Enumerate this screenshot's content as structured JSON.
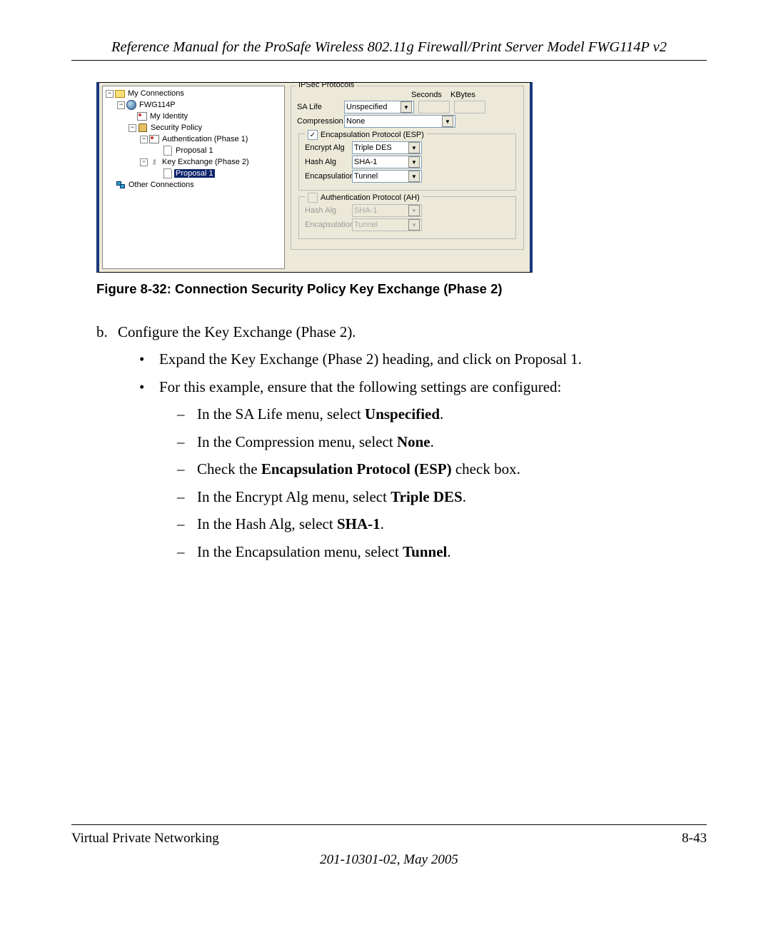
{
  "header": {
    "title": "Reference Manual for the ProSafe Wireless 802.11g  Firewall/Print Server Model FWG114P v2"
  },
  "screenshot": {
    "tree": {
      "my_connections": "My Connections",
      "fwg114p": "FWG114P",
      "my_identity": "My Identity",
      "security_policy": "Security Policy",
      "auth_phase1": "Authentication (Phase 1)",
      "proposal1_a": "Proposal 1",
      "key_exchange": "Key Exchange (Phase 2)",
      "proposal1_b": "Proposal 1",
      "other_connections": "Other Connections",
      "minus": "−",
      "open": "⊟"
    },
    "ipsec": {
      "group": "IPSec Protocols",
      "seconds": "Seconds",
      "kbytes": "KBytes",
      "sa_life": "SA Life",
      "sa_life_val": "Unspecified",
      "compression": "Compression",
      "compression_val": "None",
      "esp_check": "✓",
      "esp_label": "Encapsulation Protocol (ESP)",
      "encrypt_alg": "Encrypt Alg",
      "encrypt_alg_val": "Triple DES",
      "hash_alg": "Hash Alg",
      "hash_alg_val": "SHA-1",
      "encapsulation": "Encapsulation",
      "encapsulation_val": "Tunnel",
      "ah_label": "Authentication Protocol (AH)",
      "ah_hash_alg": "Hash Alg",
      "ah_hash_alg_val": "SHA-1",
      "ah_encap": "Encapsulation",
      "ah_encap_val": "Tunnel",
      "dd": "▼"
    }
  },
  "figure": {
    "caption": "Figure 8-32:  Connection Security Policy Key Exchange (Phase 2)"
  },
  "body": {
    "b_marker": "b.",
    "b_text": "Configure the Key Exchange (Phase 2).",
    "bullet": "•",
    "dash": "–",
    "b1": "Expand the Key Exchange (Phase 2) heading, and click on Proposal 1.",
    "b2": "For this example, ensure that the following settings are configured:",
    "d1a": "In the SA Life menu, select ",
    "d1b": "Unspecified",
    "d1c": ".",
    "d2a": "In the Compression menu, select ",
    "d2b": "None",
    "d2c": ".",
    "d3a": "Check the ",
    "d3b": "Encapsulation Protocol (ESP)",
    "d3c": " check box.",
    "d4a": "In the Encrypt Alg menu, select ",
    "d4b": "Triple DES",
    "d4c": ".",
    "d5a": "In the Hash Alg, select ",
    "d5b": "SHA-1",
    "d5c": ".",
    "d6a": "In the Encapsulation menu, select ",
    "d6b": "Tunnel",
    "d6c": "."
  },
  "footer": {
    "left": "Virtual Private Networking",
    "right": "8-43",
    "date": "201-10301-02, May 2005"
  }
}
